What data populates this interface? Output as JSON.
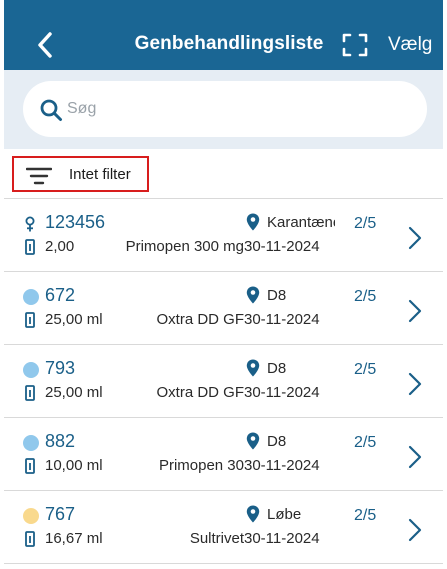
{
  "header": {
    "title": "Genbehandlingsliste",
    "select_label": "Vælg"
  },
  "search": {
    "placeholder": "Søg",
    "value": ""
  },
  "filter": {
    "label": "Intet filter"
  },
  "colors": {
    "header_bg": "#1a6694",
    "accent": "#1a5f88",
    "filter_border": "#d81d1d"
  },
  "items": [
    {
      "id": "123456",
      "marker": "female-icon",
      "location": "Karantæne",
      "count": "2/5",
      "volume": "2,00",
      "medication": "Primopen 300 mg",
      "date": "30-11-2024"
    },
    {
      "id": "672",
      "marker": "dot",
      "dot_color": "#90c8ec",
      "location": "D8",
      "count": "2/5",
      "volume": "25,00 ml",
      "medication": "Oxtra DD GF",
      "date": "30-11-2024"
    },
    {
      "id": "793",
      "marker": "dot",
      "dot_color": "#90c8ec",
      "location": "D8",
      "count": "2/5",
      "volume": "25,00 ml",
      "medication": "Oxtra DD GF",
      "date": "30-11-2024"
    },
    {
      "id": "882",
      "marker": "dot",
      "dot_color": "#90c8ec",
      "location": "D8",
      "count": "2/5",
      "volume": "10,00 ml",
      "medication": "Primopen 30",
      "date": "30-11-2024"
    },
    {
      "id": "767",
      "marker": "dot",
      "dot_color": "#f9d98d",
      "location": "Løbe",
      "count": "2/5",
      "volume": "16,67 ml",
      "medication": "Sultrivet",
      "date": "30-11-2024"
    }
  ]
}
